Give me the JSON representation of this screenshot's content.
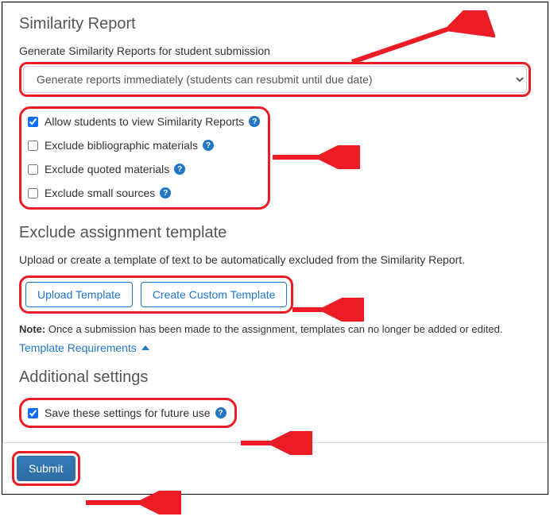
{
  "similarity": {
    "title": "Similarity Report",
    "generate_label": "Generate Similarity Reports for student submission",
    "generate_value": "Generate reports immediately (students can resubmit until due date)",
    "options": [
      {
        "key": "allow_view",
        "label": "Allow students to view Similarity Reports",
        "checked": true
      },
      {
        "key": "exclude_biblio",
        "label": "Exclude bibliographic materials",
        "checked": false
      },
      {
        "key": "exclude_quoted",
        "label": "Exclude quoted materials",
        "checked": false
      },
      {
        "key": "exclude_small",
        "label": "Exclude small sources",
        "checked": false
      }
    ]
  },
  "exclude_template": {
    "title": "Exclude assignment template",
    "desc": "Upload or create a template of text to be automatically excluded from the Similarity Report.",
    "upload_label": "Upload Template",
    "create_label": "Create Custom Template",
    "note_prefix": "Note:",
    "note_text": " Once a submission has been made to the assignment, templates can no longer be added or edited.",
    "requirements_label": "Template Requirements"
  },
  "additional": {
    "title": "Additional settings",
    "save_label": "Save these settings for future use",
    "save_checked": true
  },
  "footer": {
    "submit_label": "Submit"
  }
}
